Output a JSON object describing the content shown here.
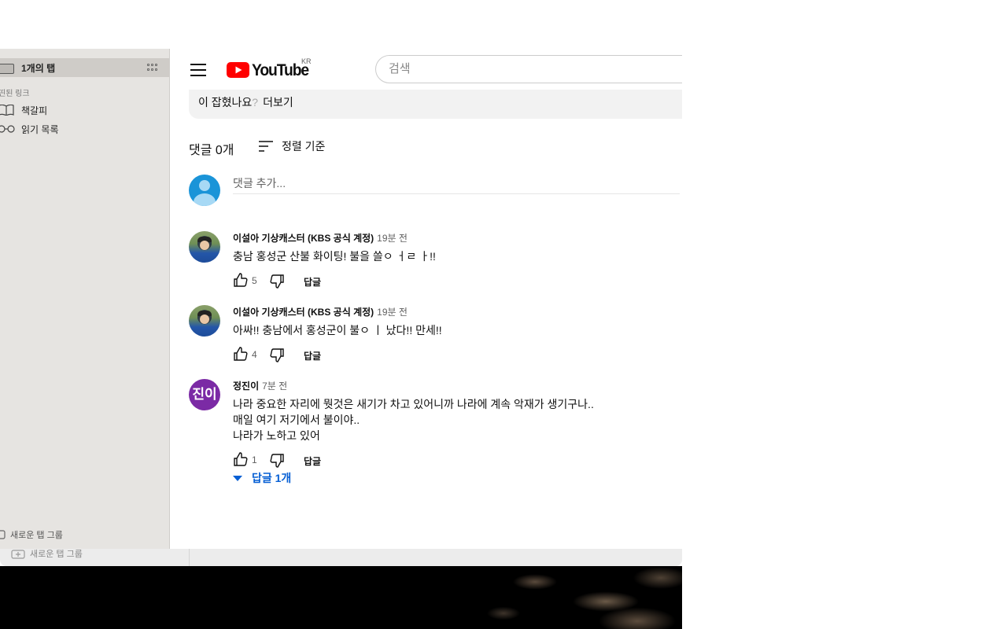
{
  "sidebar": {
    "tab_count_label": "1개의 탭",
    "pinned_links_title": "띤된 링크",
    "items": [
      {
        "label": "책갈피",
        "icon": "book-icon"
      },
      {
        "label": "읽기 목록",
        "icon": "glasses-icon"
      }
    ],
    "new_tab_group_label": "새로운 탭 그룹"
  },
  "back_window": {
    "new_tab_group_label": "새로운 탭 그룹"
  },
  "youtube": {
    "wordmark": "YouTube",
    "country_code": "KR",
    "search_placeholder": "검색",
    "brand_color": "#ff0000"
  },
  "description": {
    "text": "이 잡혔나요",
    "question_mark": "?",
    "more_label": "더보기"
  },
  "comments_section": {
    "count_label": "댓글 0개",
    "sort_label": "정렬 기준",
    "add_comment_placeholder": "댓글 추가...",
    "comments": [
      {
        "author": "이설아 기상캐스터 (KBS 공식 계정)",
        "time": "19분 전",
        "lines": [
          "충남 홍성군 산불 화이팅! 불을 쓸ㅇ ㅓㄹ ㅏ!!"
        ],
        "likes": "5",
        "reply_label": "답글"
      },
      {
        "author": "이설아 기상캐스터 (KBS 공식 계정)",
        "time": "19분 전",
        "lines": [
          "아싸!! 충남에서 홍성군이 불ㅇ ㅣ 났다!! 만세!!"
        ],
        "likes": "4",
        "reply_label": "답글"
      },
      {
        "author": "정진이",
        "avatar_letters": "진이",
        "avatar_color": "#7b2aa5",
        "time": "7분 전",
        "lines": [
          "나라 중요한 자리에 뭣것은 새기가 차고 있어니까 나라에 계속 악재가 생기구나..",
          "매일 여기 저기에서 불이야..",
          "나라가 노하고 있어"
        ],
        "likes": "1",
        "reply_label": "답글"
      }
    ],
    "replies_toggle_label": "답글 1개",
    "link_color": "#065fd4"
  }
}
